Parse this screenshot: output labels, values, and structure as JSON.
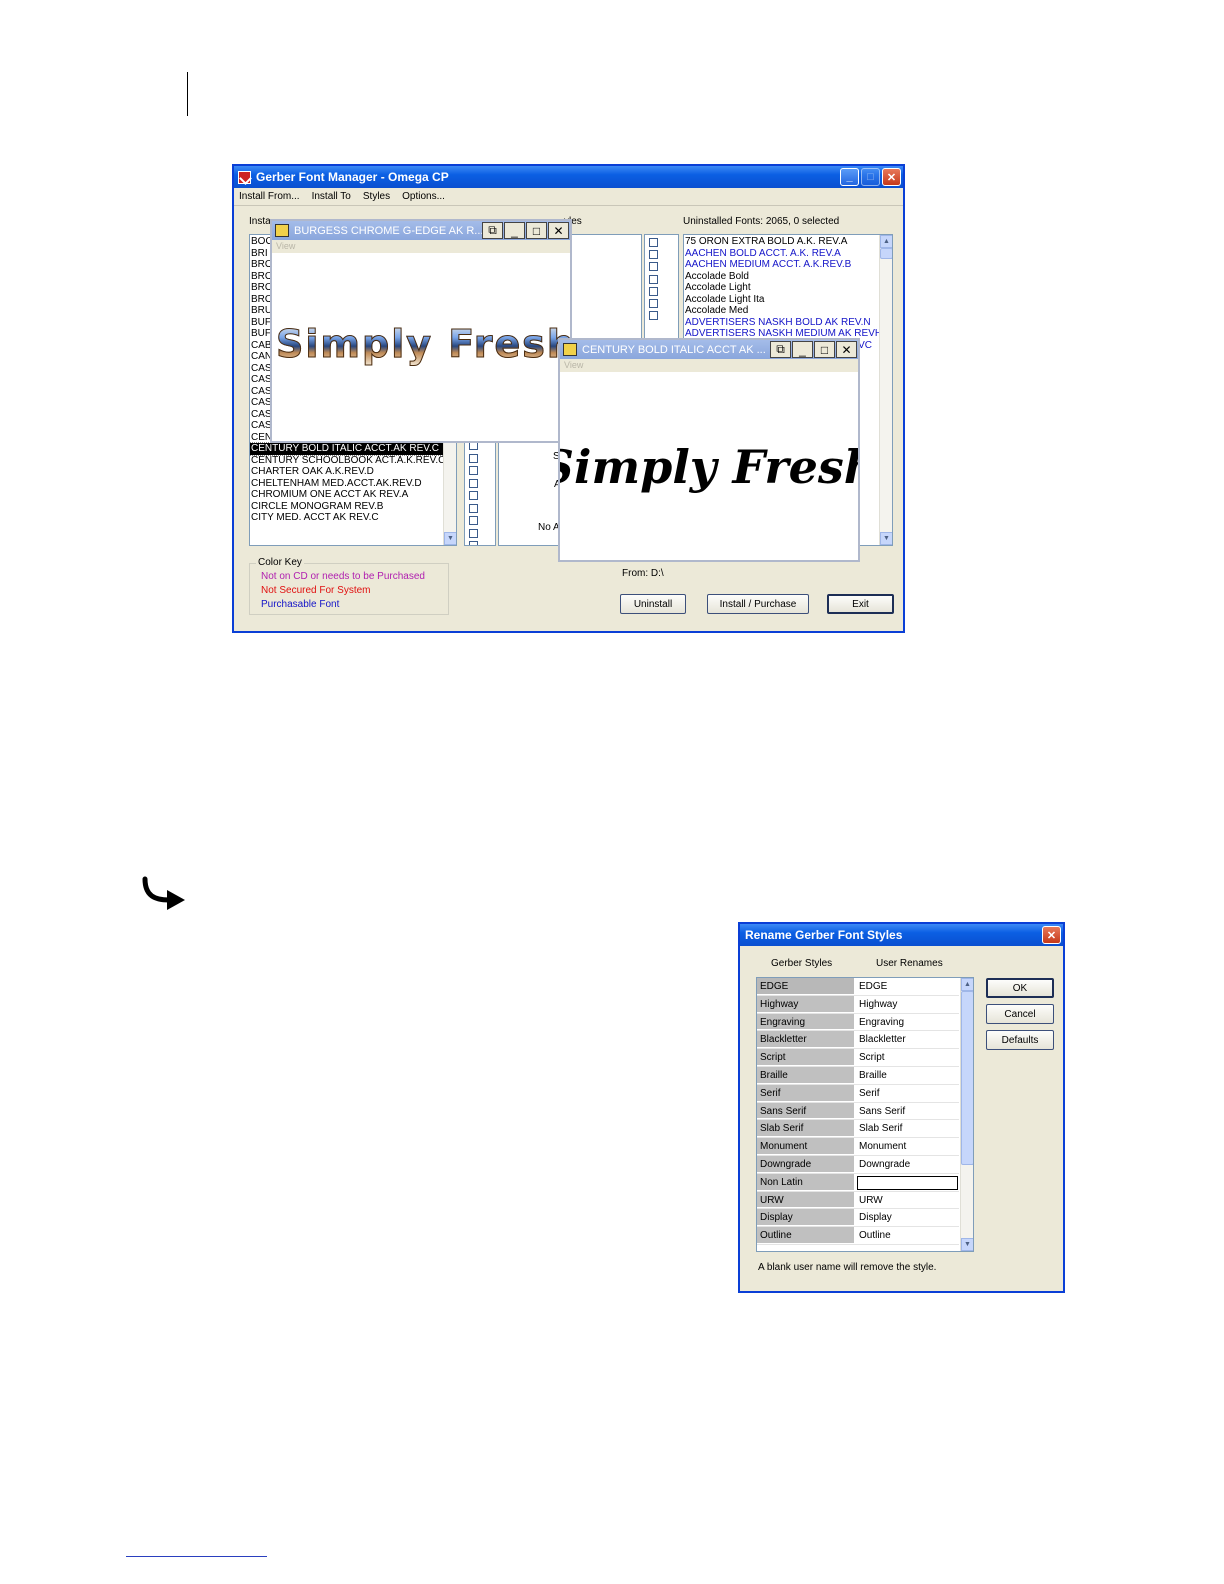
{
  "font_manager": {
    "title": "Gerber Font Manager - Omega CP",
    "menu": [
      "Install From...",
      "Install To",
      "Styles",
      "Options..."
    ],
    "installed_label_fragment": "Insta",
    "styles_label_fragment": "yles",
    "installed_fonts": [
      "BOO",
      "BRI",
      "BRO",
      "BRO",
      "BRO",
      "BRO",
      "BRU",
      "BUF",
      "BUF",
      "CAB",
      "CAN",
      "CAS",
      "CAS",
      "CAS",
      "CAS",
      "CAS",
      "CASUALEE CURSIVE CONN. AK REV.C",
      "CENTURY BOLD ACCT.A.K.REV.H",
      "CENTURY BOLD ITALIC ACCT.AK REV.C",
      "CENTURY SCHOOLBOOK ACT.A.K.REV.C",
      "CHARTER OAK A.K.REV.D",
      "CHELTENHAM MED.ACCT.AK.REV.D",
      "CHROMIUM ONE ACCT AK REV.A",
      "CIRCLE MONOGRAM REV.B",
      "CITY MED. ACCT AK REV.C"
    ],
    "selected_installed": "CENTURY BOLD ITALIC ACCT.AK REV.C",
    "style_fragments": [
      "GE",
      "way",
      "aving",
      "lletter",
      "ript",
      "ille",
      "rif"
    ],
    "middle_fragments": [
      "S",
      "A",
      "No A"
    ],
    "uninstalled_label": "Uninstalled Fonts: 2065, 0 selected",
    "uninstalled_fonts": [
      {
        "name": "75 ORON EXTRA BOLD A.K. REV.A",
        "color": "black"
      },
      {
        "name": "AACHEN BOLD ACCT. A.K. REV.A",
        "color": "blue"
      },
      {
        "name": "AACHEN MEDIUM ACCT. A.K.REV.B",
        "color": "blue"
      },
      {
        "name": "Accolade Bold",
        "color": "black"
      },
      {
        "name": "Accolade Light",
        "color": "black"
      },
      {
        "name": "Accolade Light Ita",
        "color": "black"
      },
      {
        "name": "Accolade Med",
        "color": "black"
      },
      {
        "name": "ADVERTISERS NASKH BOLD AK REV.N",
        "color": "blue"
      },
      {
        "name": "ADVERTISERS NASKH MEDIUM AK REVH",
        "color": "blue"
      },
      {
        "name": "VC",
        "color": "blue"
      }
    ],
    "color_key": {
      "legend": "Color Key",
      "items": [
        {
          "text": "Not on CD or needs to be Purchased",
          "color": "#b01fb0"
        },
        {
          "text": "Not Secured For System",
          "color": "#e01010"
        },
        {
          "text": "Purchasable Font",
          "color": "#1414c8"
        }
      ]
    },
    "from_label": "From: D:\\",
    "buttons": {
      "uninstall": "Uninstall",
      "install": "Install / Purchase",
      "exit": "Exit"
    }
  },
  "preview_burgess": {
    "title": "BURGESS CHROME G-EDGE AK R...",
    "menu": "View",
    "sample": "Simply Fresh"
  },
  "preview_century": {
    "title": "CENTURY BOLD ITALIC ACCT AK ...",
    "menu": "View",
    "sample": "Simply  Fresh"
  },
  "rename_dialog": {
    "title": "Rename Gerber Font Styles",
    "col_gerber": "Gerber Styles",
    "col_user": "User Renames",
    "rows": [
      {
        "gerber": "EDGE",
        "user": "EDGE"
      },
      {
        "gerber": "Highway",
        "user": "Highway"
      },
      {
        "gerber": "Engraving",
        "user": "Engraving"
      },
      {
        "gerber": "Blackletter",
        "user": "Blackletter"
      },
      {
        "gerber": "Script",
        "user": "Script"
      },
      {
        "gerber": "Braille",
        "user": "Braille"
      },
      {
        "gerber": "Serif",
        "user": "Serif"
      },
      {
        "gerber": "Sans Serif",
        "user": "Sans Serif"
      },
      {
        "gerber": "Slab Serif",
        "user": "Slab Serif"
      },
      {
        "gerber": "Monument",
        "user": "Monument"
      },
      {
        "gerber": "Downgrade",
        "user": "Downgrade"
      },
      {
        "gerber": "Non Latin",
        "user": ""
      },
      {
        "gerber": "URW",
        "user": "URW"
      },
      {
        "gerber": "Display",
        "user": "Display"
      },
      {
        "gerber": "Outline",
        "user": "Outline"
      }
    ],
    "buttons": {
      "ok": "OK",
      "cancel": "Cancel",
      "defaults": "Defaults"
    },
    "note": "A blank user name will remove the style."
  }
}
